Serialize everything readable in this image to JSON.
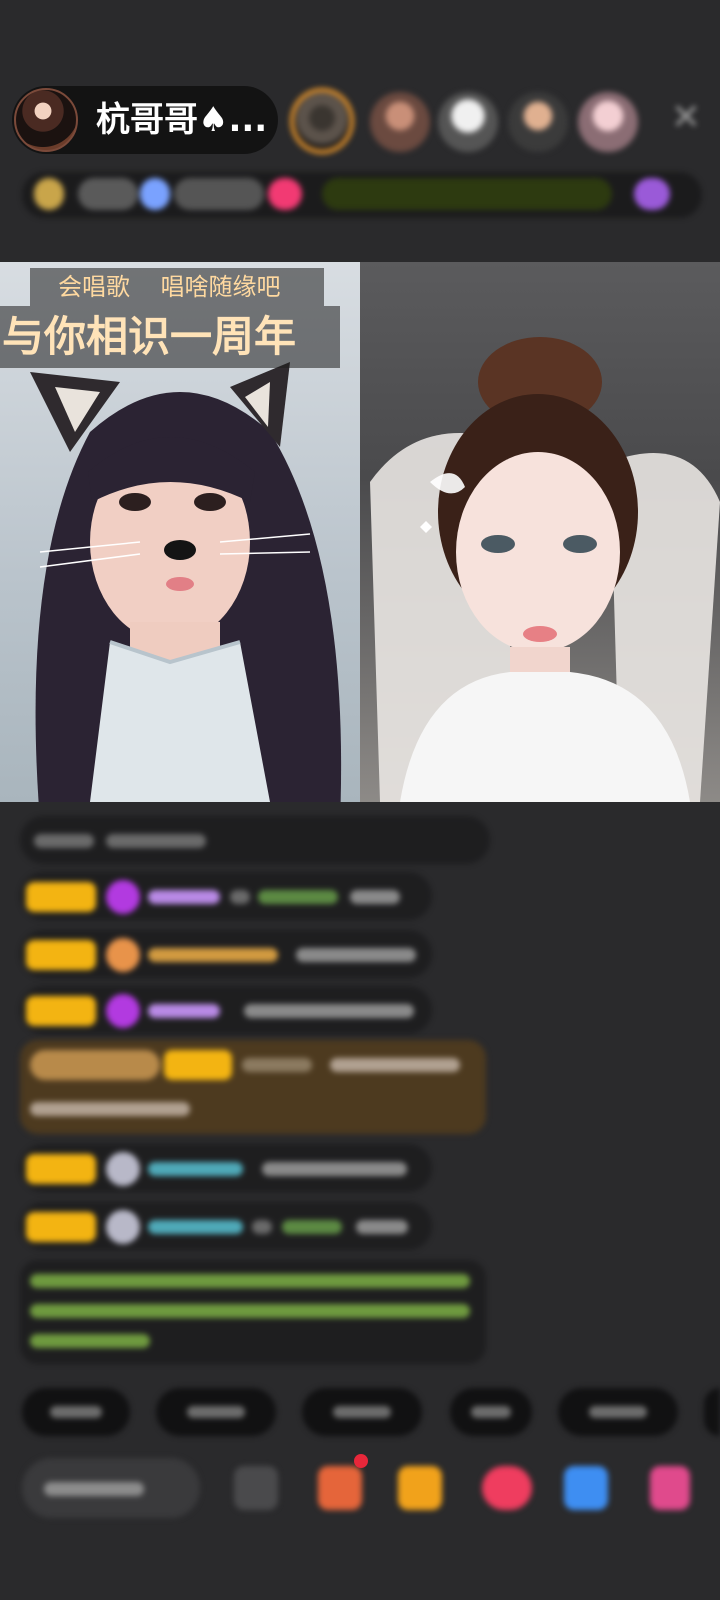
{
  "header": {
    "host_name": "杭哥哥♠...",
    "close_label": "✕"
  },
  "overlay": {
    "caption_line1": "会唱歌    唱啥随缘吧",
    "caption_line2": "与你相识一周年"
  },
  "colors": {
    "background": "#2a2a2c",
    "badge_yellow": "#f3b412",
    "caption_text": "#ffd9a0",
    "system_message_green": "#9ac85a"
  },
  "icons": {
    "close": "close-icon",
    "emoji": "emoji-icon",
    "gift": "gift-icon",
    "fans": "fans-icon",
    "game": "game-icon",
    "more": "more-apps-icon"
  }
}
